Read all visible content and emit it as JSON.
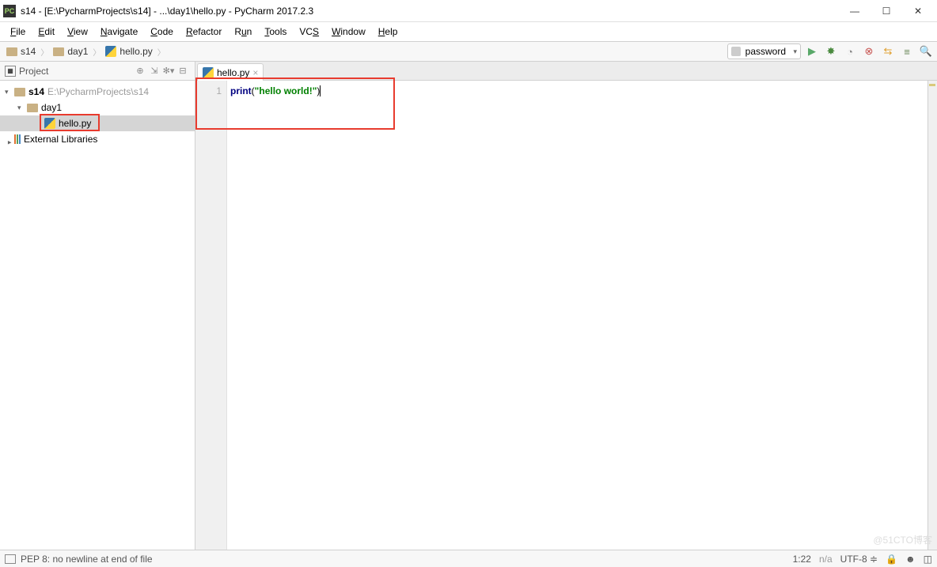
{
  "window": {
    "title": "s14 - [E:\\PycharmProjects\\s14] - ...\\day1\\hello.py - PyCharm 2017.2.3",
    "app_icon": "PC"
  },
  "menu": [
    "File",
    "Edit",
    "View",
    "Navigate",
    "Code",
    "Refactor",
    "Run",
    "Tools",
    "VCS",
    "Window",
    "Help"
  ],
  "breadcrumbs": [
    {
      "icon": "folder",
      "label": "s14"
    },
    {
      "icon": "folder",
      "label": "day1"
    },
    {
      "icon": "py",
      "label": "hello.py"
    }
  ],
  "run_config": "password",
  "project_panel": {
    "title": "Project"
  },
  "tree": {
    "root": {
      "name": "s14",
      "path": "E:\\PycharmProjects\\s14"
    },
    "folder": {
      "name": "day1"
    },
    "file": {
      "name": "hello.py"
    },
    "external": "External Libraries"
  },
  "tab": {
    "name": "hello.py"
  },
  "code": {
    "line_no": "1",
    "print": "print",
    "open": "(",
    "str": "\"hello world!\"",
    "close": ")"
  },
  "status": {
    "msg": "PEP 8: no newline at end of file",
    "pos": "1:22",
    "na": "n/a",
    "enc": "UTF-8"
  },
  "watermark": "@51CTO博客"
}
